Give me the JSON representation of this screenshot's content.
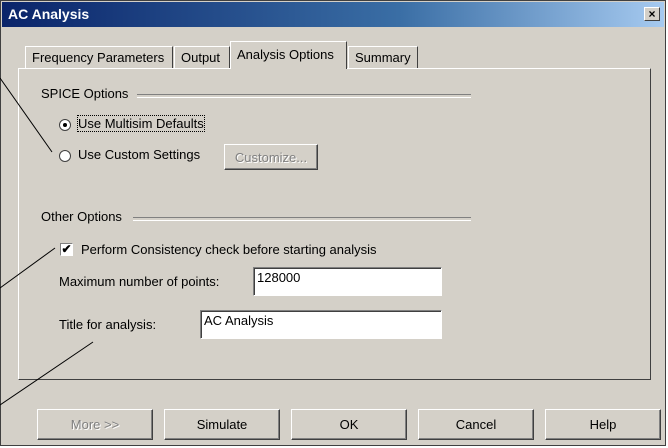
{
  "window": {
    "title": "AC Analysis",
    "close_icon": "close-icon"
  },
  "tabs": [
    {
      "label": "Frequency Parameters",
      "active": false
    },
    {
      "label": "Output",
      "active": false
    },
    {
      "label": "Analysis Options",
      "active": true
    },
    {
      "label": "Summary",
      "active": false
    }
  ],
  "spice_options": {
    "heading": "SPICE Options",
    "use_defaults_label": "Use Multisim Defaults",
    "use_defaults_selected": true,
    "use_custom_label": "Use Custom Settings",
    "use_custom_selected": false,
    "customize_label": "Customize..."
  },
  "other_options": {
    "heading": "Other Options",
    "consistency_label": "Perform Consistency check before starting analysis",
    "consistency_checked": true,
    "max_points_label": "Maximum number of points:",
    "max_points_value": "128000",
    "title_label": "Title for analysis:",
    "title_value": "AC Analysis"
  },
  "buttons": {
    "more": "More >>",
    "simulate": "Simulate",
    "ok": "OK",
    "cancel": "Cancel",
    "help": "Help"
  },
  "check_glyph": "✔"
}
